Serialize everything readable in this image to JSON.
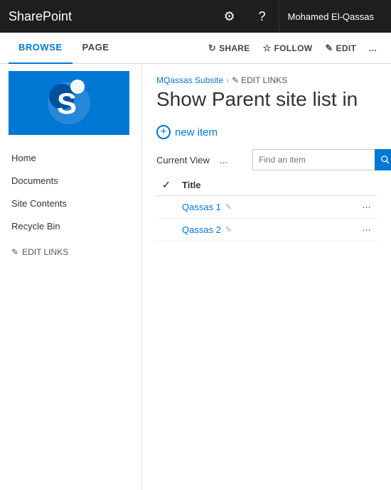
{
  "topbar": {
    "brand": "SharePoint",
    "settings_icon": "⚙",
    "help_icon": "?",
    "user_name": "Mohamed El-Qassas"
  },
  "subnav": {
    "tabs": [
      {
        "label": "BROWSE",
        "active": true
      },
      {
        "label": "PAGE",
        "active": false
      }
    ],
    "actions": [
      {
        "label": "SHARE",
        "icon": "↻"
      },
      {
        "label": "FOLLOW",
        "icon": "☆"
      },
      {
        "label": "EDIT",
        "icon": "✎"
      },
      {
        "label": "...",
        "icon": ""
      }
    ]
  },
  "sidebar": {
    "nav_items": [
      {
        "label": "Home"
      },
      {
        "label": "Documents"
      },
      {
        "label": "Site Contents"
      },
      {
        "label": "Recycle Bin"
      }
    ],
    "edit_links_label": "EDIT LINKS"
  },
  "content": {
    "breadcrumb_site": "MQassas Subsite",
    "breadcrumb_edit_label": "EDIT LINKS",
    "page_title": "Show Parent site list in",
    "new_item_label": "new item",
    "list_toolbar": {
      "current_view_label": "Current View",
      "ellipsis_label": "...",
      "search_placeholder": "Find an item"
    },
    "table": {
      "columns": [
        "",
        "Title",
        ""
      ],
      "rows": [
        {
          "title": "Qassas 1"
        },
        {
          "title": "Qassas 2"
        }
      ]
    }
  }
}
